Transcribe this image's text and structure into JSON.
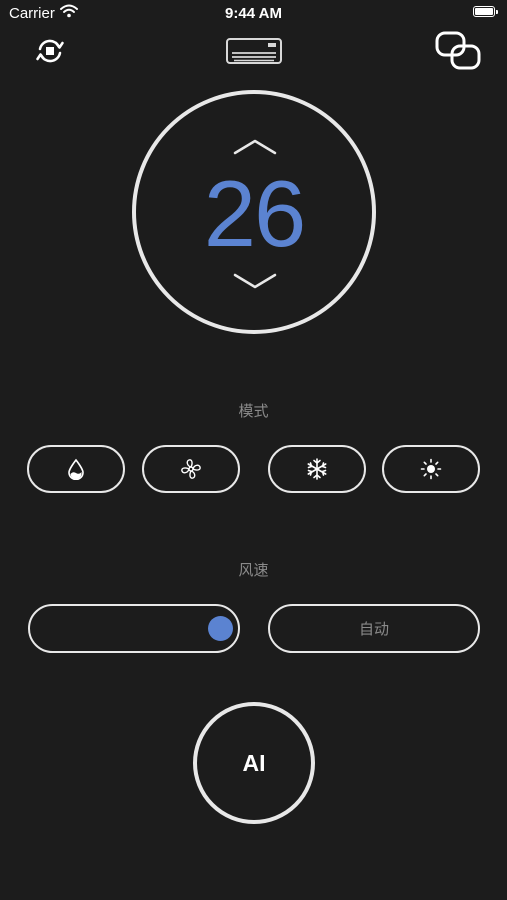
{
  "status_bar": {
    "carrier": "Carrier",
    "time": "9:44 AM",
    "battery_level": 1.0
  },
  "nav": {
    "left_icon": "sync-icon",
    "center_icon": "air-conditioner-icon",
    "right_icon": "link-icon"
  },
  "temperature": {
    "value": "26",
    "up_icon": "chevron-up-icon",
    "down_icon": "chevron-down-icon"
  },
  "mode": {
    "label": "模式",
    "options": [
      {
        "icon": "dehumidify-drop-icon"
      },
      {
        "icon": "fan-icon"
      },
      {
        "icon": "snowflake-cool-icon"
      },
      {
        "icon": "sun-heat-icon"
      }
    ]
  },
  "fan_speed": {
    "label": "风速",
    "slider_value": 1.0,
    "auto_label": "自动"
  },
  "ai": {
    "label": "AI"
  },
  "colors": {
    "background": "#1c1c1c",
    "accent": "#5b83d1",
    "outline": "#e8e8e8",
    "muted_text": "#8a8a8a"
  }
}
